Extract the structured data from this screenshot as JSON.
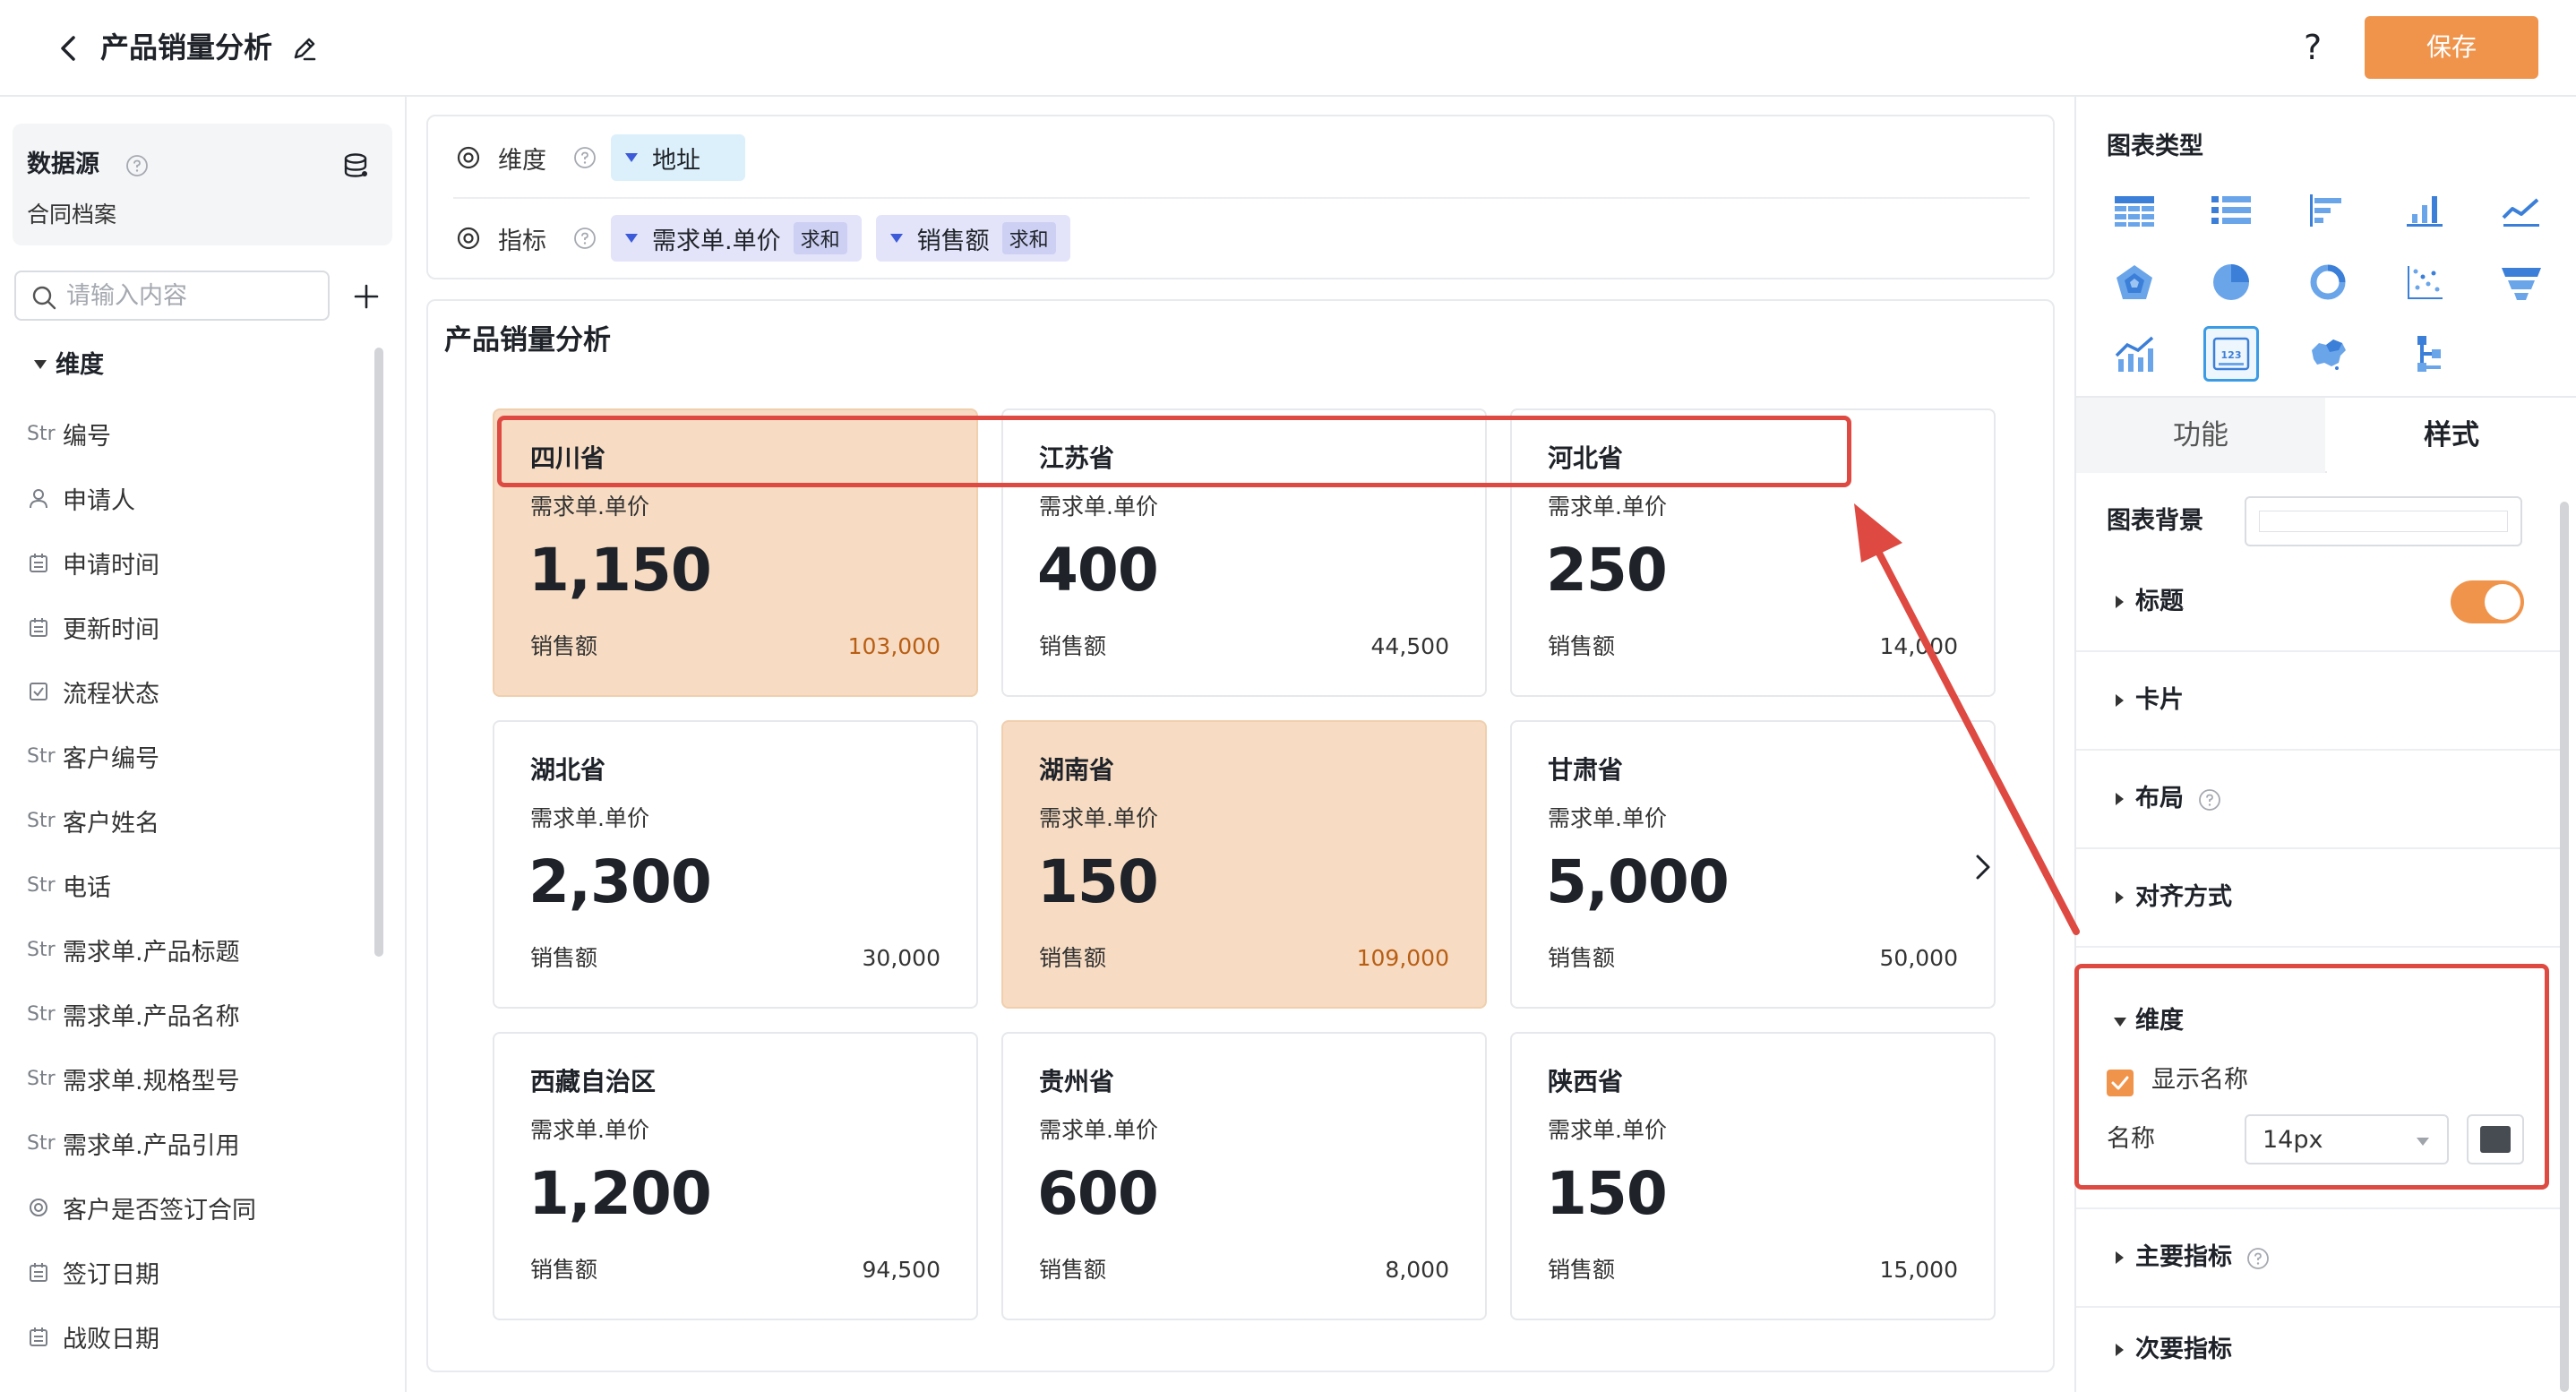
{
  "header": {
    "title": "产品销量分析",
    "help": "?",
    "save_label": "保存"
  },
  "left_panel": {
    "datasource_title": "数据源",
    "datasource_name": "合同档案",
    "search_placeholder": "请输入内容",
    "dimension_header": "维度",
    "fields": [
      {
        "type": "Str",
        "icon": "string-icon",
        "label": "编号"
      },
      {
        "type": "",
        "icon": "person-icon",
        "label": "申请人"
      },
      {
        "type": "",
        "icon": "calendar-icon",
        "label": "申请时间"
      },
      {
        "type": "",
        "icon": "calendar-icon",
        "label": "更新时间"
      },
      {
        "type": "",
        "icon": "checkbox-icon",
        "label": "流程状态"
      },
      {
        "type": "Str",
        "icon": "string-icon",
        "label": "客户编号"
      },
      {
        "type": "Str",
        "icon": "string-icon",
        "label": "客户姓名"
      },
      {
        "type": "Str",
        "icon": "string-icon",
        "label": "电话"
      },
      {
        "type": "Str",
        "icon": "string-icon",
        "label": "需求单.产品标题"
      },
      {
        "type": "Str",
        "icon": "string-icon",
        "label": "需求单.产品名称"
      },
      {
        "type": "Str",
        "icon": "string-icon",
        "label": "需求单.规格型号"
      },
      {
        "type": "Str",
        "icon": "string-icon",
        "label": "需求单.产品引用"
      },
      {
        "type": "",
        "icon": "radio-icon",
        "label": "客户是否签订合同"
      },
      {
        "type": "",
        "icon": "calendar-icon",
        "label": "签订日期"
      },
      {
        "type": "",
        "icon": "calendar-icon",
        "label": "战败日期"
      }
    ]
  },
  "config": {
    "dimension_label": "维度",
    "dimension_chip": "地址",
    "metric_label": "指标",
    "metrics": [
      {
        "name": "需求单.单价",
        "agg": "求和"
      },
      {
        "name": "销售额",
        "agg": "求和"
      }
    ]
  },
  "chart": {
    "title": "产品销量分析",
    "metric_label": "需求单.单价",
    "sub_label": "销售额",
    "highlight_color": "#f7dcc3",
    "cards": [
      {
        "name": "四川省",
        "value": "1,150",
        "sub": "103,000",
        "highlight": true
      },
      {
        "name": "江苏省",
        "value": "400",
        "sub": "44,500",
        "highlight": false
      },
      {
        "name": "河北省",
        "value": "250",
        "sub": "14,000",
        "highlight": false
      },
      {
        "name": "湖北省",
        "value": "2,300",
        "sub": "30,000",
        "highlight": false
      },
      {
        "name": "湖南省",
        "value": "150",
        "sub": "109,000",
        "highlight": true
      },
      {
        "name": "甘肃省",
        "value": "5,000",
        "sub": "50,000",
        "highlight": false
      },
      {
        "name": "西藏自治区",
        "value": "1,200",
        "sub": "94,500",
        "highlight": false
      },
      {
        "name": "贵州省",
        "value": "600",
        "sub": "8,000",
        "highlight": false
      },
      {
        "name": "陕西省",
        "value": "150",
        "sub": "15,000",
        "highlight": false
      }
    ]
  },
  "right_panel": {
    "chart_type_title": "图表类型",
    "chart_types": [
      "table-icon",
      "list-icon",
      "bar-horizontal-icon",
      "bar-vertical-icon",
      "line-chart-icon",
      "radar-icon",
      "pie-icon",
      "donut-icon",
      "scatter-icon",
      "funnel-icon",
      "combo-chart-icon",
      "indicator-card-icon",
      "map-icon",
      "tree-icon"
    ],
    "active_chart_type": "indicator-card-icon",
    "tab_function": "功能",
    "tab_style": "样式",
    "bg_label": "图表背景",
    "sections": {
      "title": "标题",
      "card": "卡片",
      "layout": "布局",
      "align": "对齐方式",
      "dimension": "维度",
      "primary_metric": "主要指标",
      "secondary_metric": "次要指标"
    },
    "title_toggle_on": true,
    "show_name_label": "显示名称",
    "show_name_checked": true,
    "name_label": "名称",
    "font_size": "14px",
    "name_color": "#474b52",
    "accent_color": "#f0944c",
    "annotation_color": "#de4a42"
  }
}
